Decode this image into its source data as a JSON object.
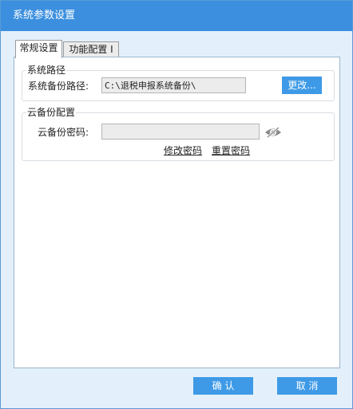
{
  "window": {
    "title": "系统参数设置"
  },
  "tabs": [
    {
      "label": "常规设置",
      "active": true
    },
    {
      "label": "功能配置 I",
      "active": false
    }
  ],
  "system_path": {
    "legend": "系统路径",
    "backup_path_label": "系统备份路径:",
    "backup_path_value": "C:\\退税申报系统备份\\",
    "change_button": "更改..."
  },
  "cloud_backup": {
    "legend": "云备份配置",
    "password_label": "云备份密码:",
    "password_value": "",
    "eye_icon": "eye-slash-icon",
    "modify_password_link": "修改密码",
    "reset_password_link": "重置密码"
  },
  "footer": {
    "confirm_button": "确 认",
    "cancel_button": "取 消"
  },
  "colors": {
    "titlebar": "#3b8fde",
    "window_bg": "#e3f0fb",
    "button": "#3e9ae6"
  }
}
